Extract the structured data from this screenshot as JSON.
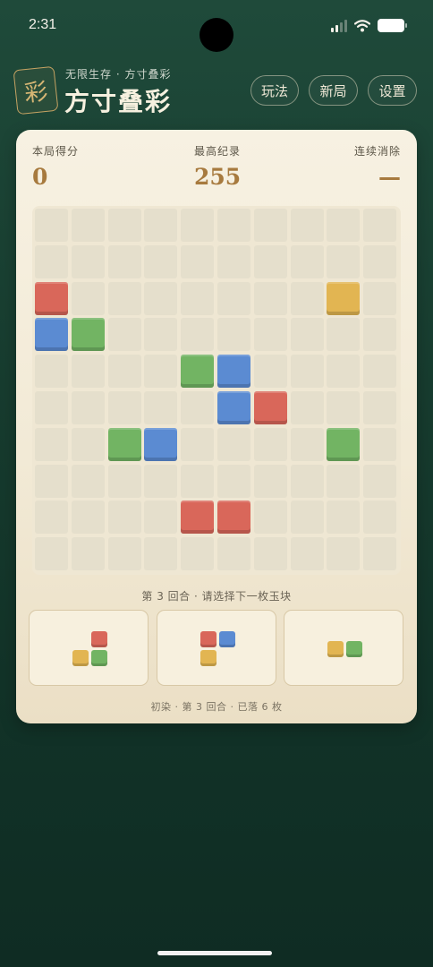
{
  "status_bar": {
    "time": "2:31"
  },
  "header": {
    "logo_char": "彩",
    "subtitle": "无限生存 · 方寸叠彩",
    "title": "方寸叠彩",
    "buttons": {
      "rules": "玩法",
      "new_game": "新局",
      "settings": "设置"
    }
  },
  "stats": {
    "score_label": "本局得分",
    "score_value": "0",
    "best_label": "最高纪录",
    "best_value": "255",
    "combo_label": "连续消除",
    "combo_value": "—"
  },
  "colors": {
    "red": "#d9675a",
    "blue": "#5b8bd2",
    "green": "#72b463",
    "yellow": "#e2b552"
  },
  "board": {
    "rows": 10,
    "cols": 10,
    "tiles": [
      {
        "row": 2,
        "col": 0,
        "color": "red"
      },
      {
        "row": 2,
        "col": 8,
        "color": "yellow"
      },
      {
        "row": 3,
        "col": 0,
        "color": "blue"
      },
      {
        "row": 3,
        "col": 1,
        "color": "green"
      },
      {
        "row": 4,
        "col": 4,
        "color": "green"
      },
      {
        "row": 4,
        "col": 5,
        "color": "blue"
      },
      {
        "row": 5,
        "col": 5,
        "color": "blue"
      },
      {
        "row": 5,
        "col": 6,
        "color": "red"
      },
      {
        "row": 6,
        "col": 2,
        "color": "green"
      },
      {
        "row": 6,
        "col": 3,
        "color": "blue"
      },
      {
        "row": 6,
        "col": 8,
        "color": "green"
      },
      {
        "row": 8,
        "col": 4,
        "color": "red"
      },
      {
        "row": 8,
        "col": 5,
        "color": "red"
      }
    ]
  },
  "round_hint": "第 3 回合 · 请选择下一枚玉块",
  "pieces": [
    {
      "blocks": [
        {
          "row": 0,
          "col": 1,
          "color": "red"
        },
        {
          "row": 1,
          "col": 0,
          "color": "yellow"
        },
        {
          "row": 1,
          "col": 1,
          "color": "green"
        }
      ]
    },
    {
      "blocks": [
        {
          "row": 0,
          "col": 0,
          "color": "red"
        },
        {
          "row": 0,
          "col": 1,
          "color": "blue"
        },
        {
          "row": 1,
          "col": 0,
          "color": "yellow"
        }
      ]
    },
    {
      "blocks": [
        {
          "row": 0,
          "col": 0,
          "color": "yellow"
        },
        {
          "row": 0,
          "col": 1,
          "color": "green"
        }
      ]
    }
  ],
  "footer_status": "初染 · 第 3 回合 · 已落 6 枚"
}
